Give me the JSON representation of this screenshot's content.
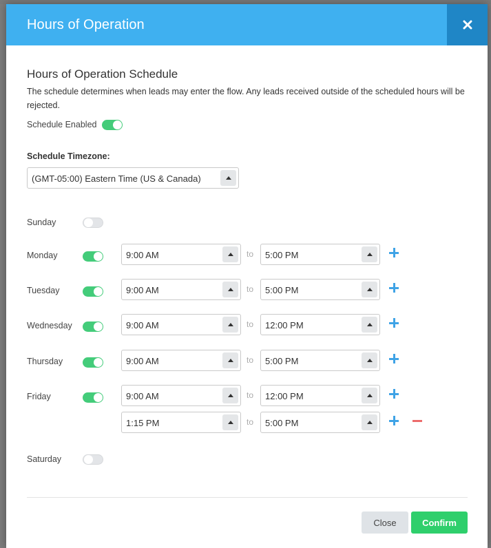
{
  "modal": {
    "title": "Hours of Operation",
    "close_icon": "close-icon"
  },
  "schedule": {
    "heading": "Hours of Operation Schedule",
    "description": "The schedule determines when leads may enter the flow. Any leads received outside of the scheduled hours will be rejected.",
    "enabled_label": "Schedule Enabled",
    "enabled": true,
    "timezone_label": "Schedule Timezone:",
    "timezone_value": "(GMT-05:00) Eastern Time (US & Canada)"
  },
  "to_label": "to",
  "days": [
    {
      "name": "Sunday",
      "enabled": false,
      "ranges": []
    },
    {
      "name": "Monday",
      "enabled": true,
      "ranges": [
        {
          "start": "9:00 AM",
          "end": "5:00 PM"
        }
      ]
    },
    {
      "name": "Tuesday",
      "enabled": true,
      "ranges": [
        {
          "start": "9:00 AM",
          "end": "5:00 PM"
        }
      ]
    },
    {
      "name": "Wednesday",
      "enabled": true,
      "ranges": [
        {
          "start": "9:00 AM",
          "end": "12:00 PM"
        }
      ]
    },
    {
      "name": "Thursday",
      "enabled": true,
      "ranges": [
        {
          "start": "9:00 AM",
          "end": "5:00 PM"
        }
      ]
    },
    {
      "name": "Friday",
      "enabled": true,
      "ranges": [
        {
          "start": "9:00 AM",
          "end": "12:00 PM"
        },
        {
          "start": "1:15 PM",
          "end": "5:00 PM"
        }
      ]
    },
    {
      "name": "Saturday",
      "enabled": false,
      "ranges": []
    }
  ],
  "footer": {
    "close_label": "Close",
    "confirm_label": "Confirm"
  },
  "colors": {
    "header": "#3fb0f0",
    "header_close": "#1f86c6",
    "toggle_on": "#44cc7a",
    "confirm": "#2fcf6c",
    "add": "#3fa3e6",
    "remove": "#ec6b6b"
  }
}
